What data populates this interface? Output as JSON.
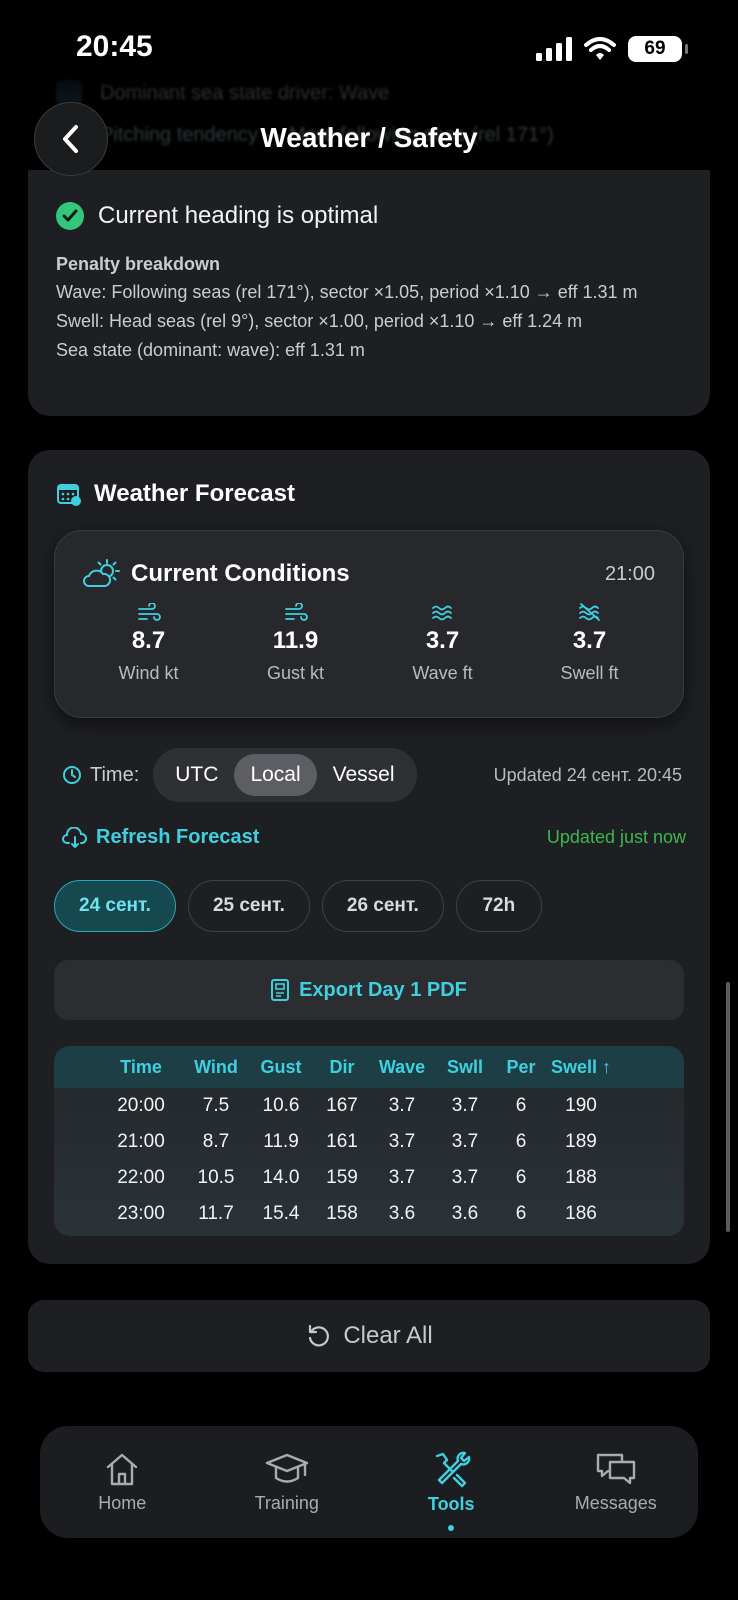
{
  "status_bar": {
    "time": "20:45",
    "battery": "69"
  },
  "ghost": {
    "row1": "Dominant sea state driver: Wave",
    "row2": "Pitching tendency — More following seas (rel 171°)"
  },
  "header": {
    "title": "Weather / Safety",
    "back_icon": "chevron-left-icon"
  },
  "heading_card": {
    "optimal_text": "Current heading is optimal",
    "penalty_title": "Penalty breakdown",
    "penalty_lines": [
      "Wave: Following seas (rel 171°), sector ×1.05, period ×1.10 → eff 1.31 m",
      "Swell: Head seas (rel 9°), sector ×1.00, period ×1.10 → eff 1.24 m",
      "Sea state (dominant: wave): eff 1.31 m"
    ]
  },
  "forecast": {
    "title": "Weather Forecast",
    "current": {
      "title": "Current Conditions",
      "time": "21:00",
      "metrics": [
        {
          "value": "8.7",
          "label": "Wind kt"
        },
        {
          "value": "11.9",
          "label": "Gust kt"
        },
        {
          "value": "3.7",
          "label": "Wave ft"
        },
        {
          "value": "3.7",
          "label": "Swell ft"
        }
      ]
    },
    "time_label": "Time:",
    "time_options": [
      "UTC",
      "Local",
      "Vessel"
    ],
    "selected_time": "Local",
    "updated_date": "Updated 24 сент. 20:45",
    "refresh_label": "Refresh Forecast",
    "updated_now": "Updated just now",
    "days": [
      "24 сент.",
      "25 сент.",
      "26 сент.",
      "72h"
    ],
    "selected_day": "24 сент.",
    "export_label": "Export Day 1 PDF",
    "table": {
      "headers": [
        "Time",
        "Wind",
        "Gust",
        "Dir",
        "Wave",
        "Swll",
        "Per",
        "Swell ↑"
      ],
      "rows": [
        [
          "20:00",
          "7.5",
          "10.6",
          "167",
          "3.7",
          "3.7",
          "6",
          "190"
        ],
        [
          "21:00",
          "8.7",
          "11.9",
          "161",
          "3.7",
          "3.7",
          "6",
          "189"
        ],
        [
          "22:00",
          "10.5",
          "14.0",
          "159",
          "3.7",
          "3.7",
          "6",
          "188"
        ],
        [
          "23:00",
          "11.7",
          "15.4",
          "158",
          "3.6",
          "3.6",
          "6",
          "186"
        ]
      ]
    }
  },
  "clear_all_label": "Clear All",
  "tabs": [
    {
      "label": "Home",
      "icon": "home-icon"
    },
    {
      "label": "Training",
      "icon": "graduation-cap-icon"
    },
    {
      "label": "Tools",
      "icon": "tools-icon",
      "active": true
    },
    {
      "label": "Messages",
      "icon": "messages-icon"
    }
  ],
  "colors": {
    "accent": "#3fd0e0",
    "success": "#34c77b",
    "updated": "#3db64f",
    "card": "#1e1f22"
  }
}
